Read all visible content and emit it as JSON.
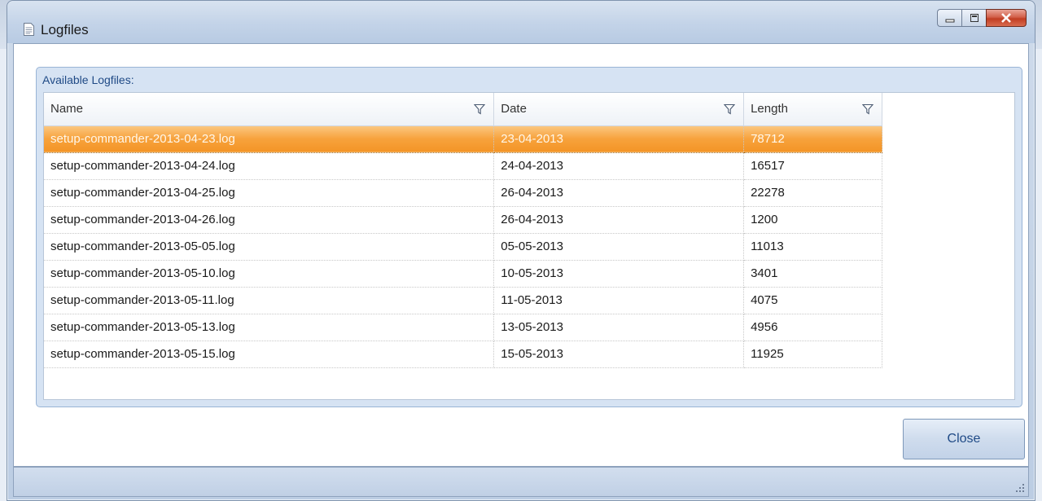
{
  "window": {
    "title": "Logfiles",
    "icon": "document-icon"
  },
  "groupbox": {
    "caption": "Available Logfiles:"
  },
  "grid": {
    "columns": [
      "Name",
      "Date",
      "Length"
    ],
    "rows": [
      {
        "name": "setup-commander-2013-04-23.log",
        "date": "23-04-2013",
        "length": "78712",
        "selected": true
      },
      {
        "name": "setup-commander-2013-04-24.log",
        "date": "24-04-2013",
        "length": "16517"
      },
      {
        "name": "setup-commander-2013-04-25.log",
        "date": "26-04-2013",
        "length": "22278"
      },
      {
        "name": "setup-commander-2013-04-26.log",
        "date": "26-04-2013",
        "length": "1200"
      },
      {
        "name": "setup-commander-2013-05-05.log",
        "date": "05-05-2013",
        "length": "11013"
      },
      {
        "name": "setup-commander-2013-05-10.log",
        "date": "10-05-2013",
        "length": "3401"
      },
      {
        "name": "setup-commander-2013-05-11.log",
        "date": "11-05-2013",
        "length": "4075"
      },
      {
        "name": "setup-commander-2013-05-13.log",
        "date": "13-05-2013",
        "length": "4956"
      },
      {
        "name": "setup-commander-2013-05-15.log",
        "date": "15-05-2013",
        "length": "11925"
      }
    ]
  },
  "buttons": {
    "close_label": "Close"
  },
  "colors": {
    "selection": "#f7a23c",
    "accent_text": "#1f4a86"
  }
}
